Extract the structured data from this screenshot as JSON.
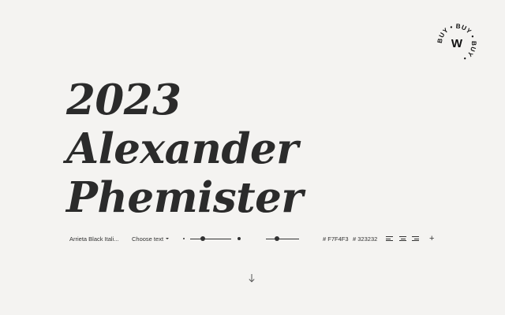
{
  "badge": {
    "ring_text": "BUY • BUY • BUY • ",
    "letter": "W"
  },
  "specimen": {
    "lines": [
      "2023",
      "Alexander",
      "Phemister"
    ]
  },
  "toolbar": {
    "font_name": "Arrieta Black Itali...",
    "choose_text": "Choose text",
    "font_size_value": 0.3,
    "line_height_value": 0.33,
    "background_color": "# F7F4F3",
    "text_color": "# 323232"
  },
  "icons": {
    "size_small": "dot-small-icon",
    "size_large": "dot-large-icon",
    "line_height_tight": "line-height-tight-icon",
    "line_height_loose": "line-height-loose-icon",
    "align_left": "align-left-icon",
    "align_center": "align-center-icon",
    "align_right": "align-right-icon",
    "add": "plus-icon",
    "scroll": "arrow-down-icon"
  },
  "colors": {
    "background": "#F4F3F1",
    "text": "#323232"
  }
}
